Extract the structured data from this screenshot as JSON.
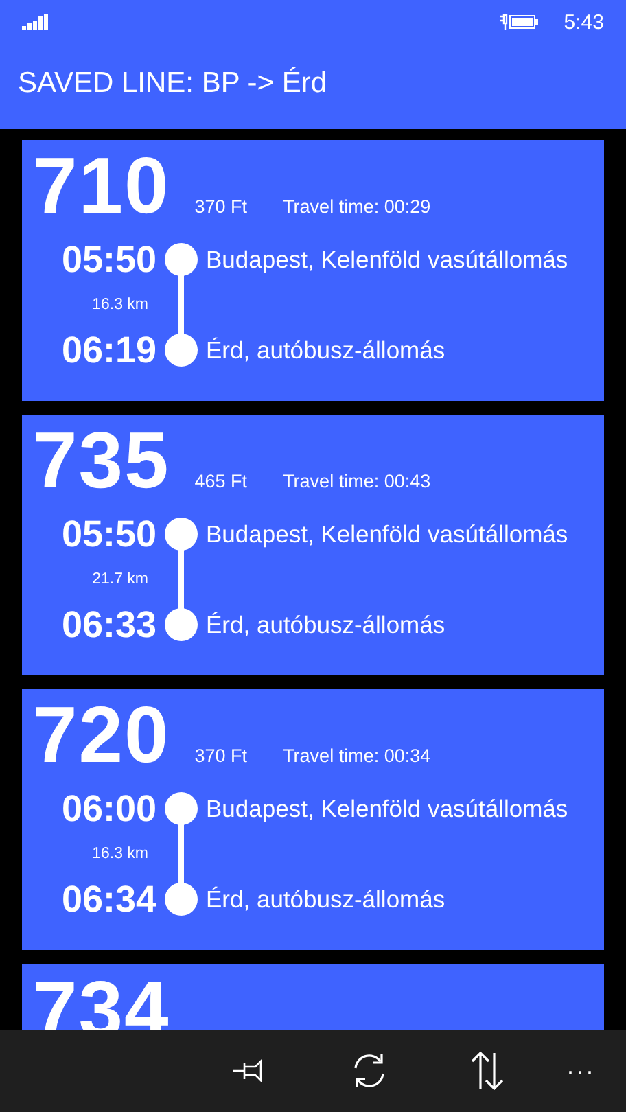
{
  "status_bar": {
    "time": "5:43"
  },
  "header": {
    "title": "SAVED LINE: BP -> Érd"
  },
  "trips": [
    {
      "line": "710",
      "price": "370 Ft",
      "travel_time": "Travel time: 00:29",
      "depart_time": "05:50",
      "depart_stop": "Budapest, Kelenföld vasútállomás",
      "distance": "16.3 km",
      "arrive_time": "06:19",
      "arrive_stop": "Érd, autóbusz-állomás"
    },
    {
      "line": "735",
      "price": "465 Ft",
      "travel_time": "Travel time: 00:43",
      "depart_time": "05:50",
      "depart_stop": "Budapest, Kelenföld vasútállomás",
      "distance": "21.7 km",
      "arrive_time": "06:33",
      "arrive_stop": "Érd, autóbusz-állomás"
    },
    {
      "line": "720",
      "price": "370 Ft",
      "travel_time": "Travel time: 00:34",
      "depart_time": "06:00",
      "depart_stop": "Budapest, Kelenföld vasútállomás",
      "distance": "16.3 km",
      "arrive_time": "06:34",
      "arrive_stop": "Érd, autóbusz-állomás"
    },
    {
      "line": "734"
    }
  ],
  "app_bar": {
    "more": "···"
  }
}
